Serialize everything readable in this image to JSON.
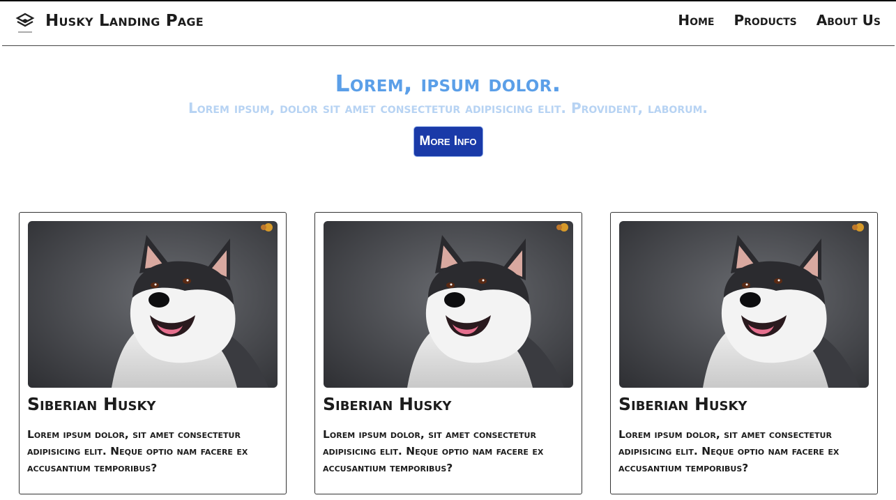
{
  "navbar": {
    "brand_title": "Husky Landing Page",
    "logo_icon": "layers-logo-icon",
    "links": [
      "Home",
      "Products",
      "About Us"
    ]
  },
  "hero": {
    "title": "Lorem, ipsum dolor.",
    "subtitle": "Lorem ipsum, dolor sit amet consectetur adipisicing elit. Provident, laborum.",
    "button_label": "More Info",
    "colors": {
      "title": "#5b9fe8",
      "subtitle": "#b7d3f3",
      "button": "#1a3aa8"
    }
  },
  "cards": [
    {
      "title": "Siberian Husky",
      "text": "Lorem ipsum dolor, sit amet consectetur adipisicing elit. Neque optio nam facere ex accusantium temporibus?",
      "image_icon": "husky-photo"
    },
    {
      "title": "Siberian Husky",
      "text": "Lorem ipsum dolor, sit amet consectetur adipisicing elit. Neque optio nam facere ex accusantium temporibus?",
      "image_icon": "husky-photo"
    },
    {
      "title": "Siberian Husky",
      "text": "Lorem ipsum dolor, sit amet consectetur adipisicing elit. Neque optio nam facere ex accusantium temporibus?",
      "image_icon": "husky-photo"
    }
  ]
}
